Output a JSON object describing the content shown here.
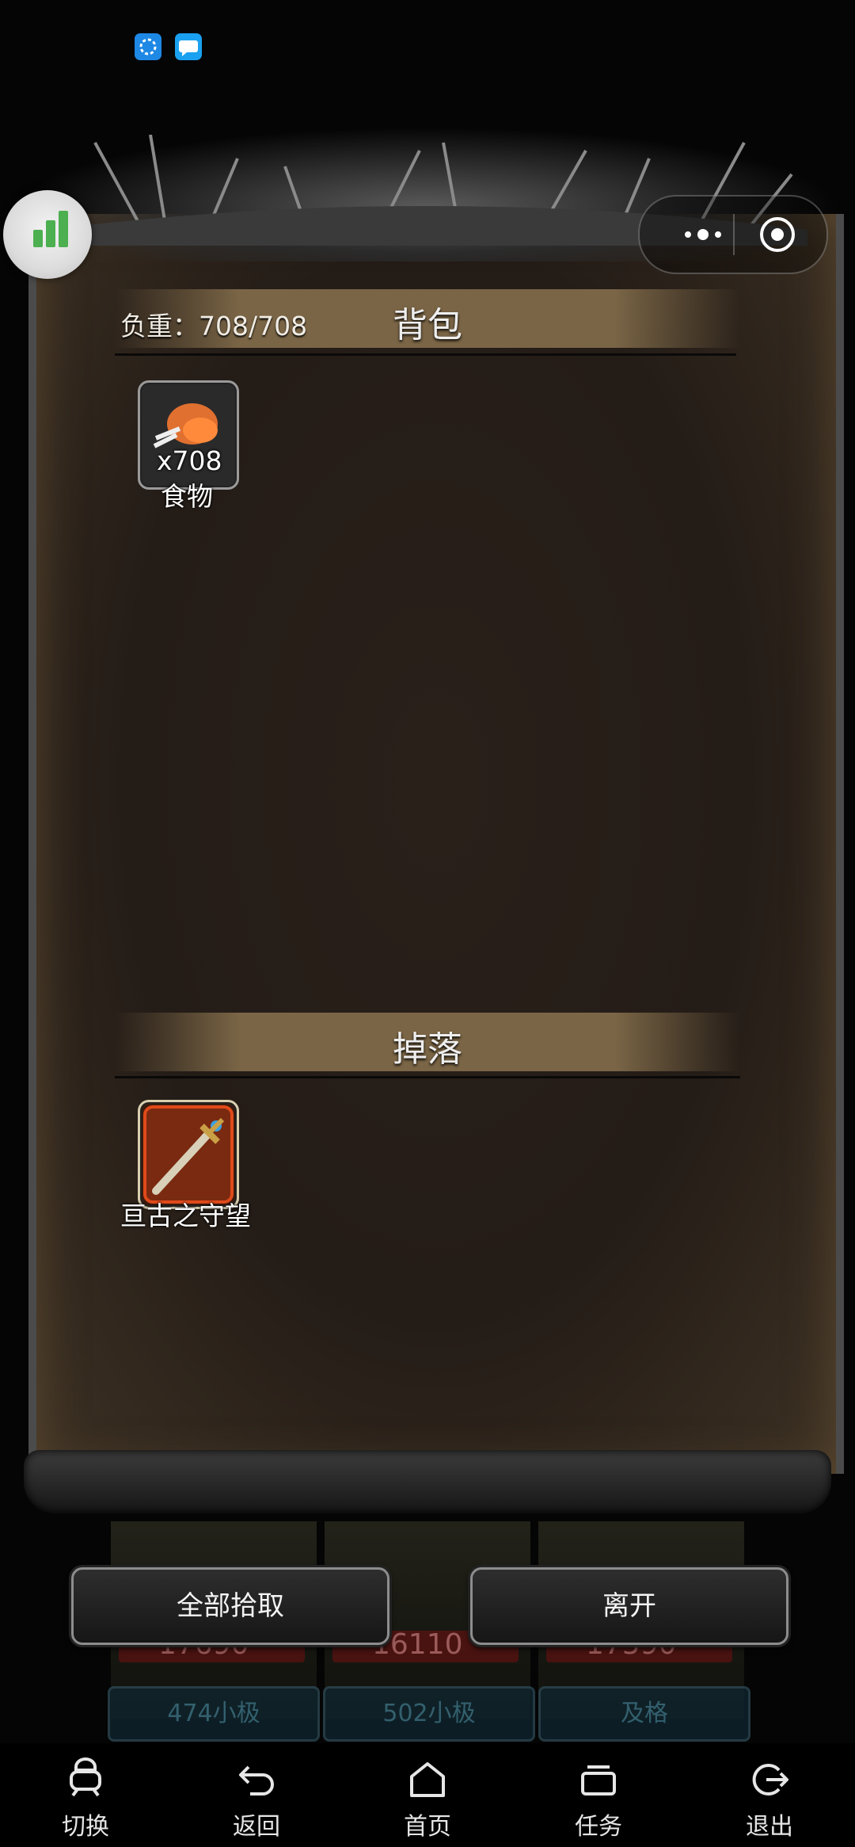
{
  "panel": {
    "weight_text": "负重：708/708",
    "backpack_title": "背包",
    "drop_title": "掉落"
  },
  "backpack_items": [
    {
      "count": "x708",
      "name": "食物",
      "icon": "drumstick-icon"
    }
  ],
  "drop_items": [
    {
      "name": "亘古之守望",
      "icon": "sword-icon"
    }
  ],
  "background": {
    "numbers": [
      "17690",
      "16110",
      "17590"
    ],
    "tags": [
      "474小极",
      "502小极",
      "及格"
    ]
  },
  "actions": {
    "pickup_all": "全部拾取",
    "leave": "离开"
  },
  "bottom_nav": [
    {
      "label": "切换",
      "icon": "switch-icon"
    },
    {
      "label": "返回",
      "icon": "undo-icon"
    },
    {
      "label": "首页",
      "icon": "home-icon"
    },
    {
      "label": "任务",
      "icon": "task-icon"
    },
    {
      "label": "退出",
      "icon": "exit-icon"
    }
  ],
  "colors": {
    "panel_bg": "#241c17",
    "section_bar": "#967d55",
    "widget_green": "#4caf50"
  }
}
